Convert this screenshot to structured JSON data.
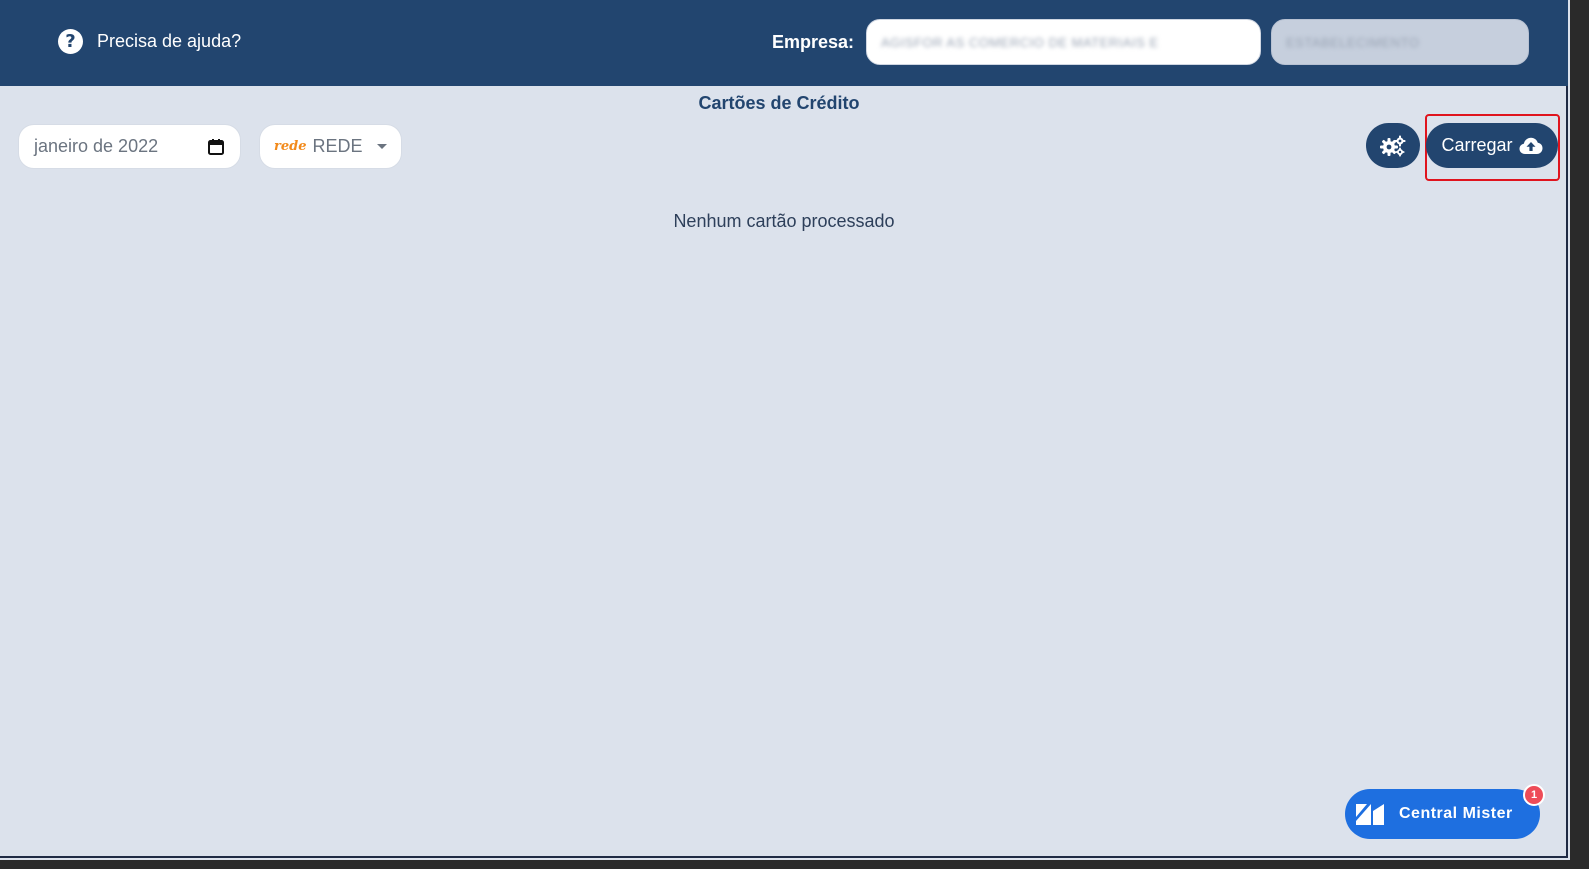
{
  "header": {
    "help_text": "Precisa de ajuda?",
    "company_label": "Empresa:",
    "company_value": "AGISFOR AS COMERCIO DE MATERIAIS E",
    "establishment_value": "ESTABELECIMENTO"
  },
  "page": {
    "title": "Cartões de Crédito",
    "empty_message": "Nenhum cartão processado"
  },
  "filters": {
    "month_value": "janeiro de 2022",
    "brand_logo": "rede",
    "brand_value": "REDE"
  },
  "actions": {
    "settings_icon": "gears-icon",
    "upload_label": "Carregar",
    "upload_icon": "cloud-upload-icon"
  },
  "widget": {
    "label": "Central Mister",
    "badge_count": "1"
  },
  "colors": {
    "header_bg": "#22456f",
    "page_bg": "#dce2ec",
    "accent": "#22456f",
    "highlight": "#e0141e",
    "widget_bg": "#1e6fe0",
    "brand_orange": "#f28a1b"
  }
}
